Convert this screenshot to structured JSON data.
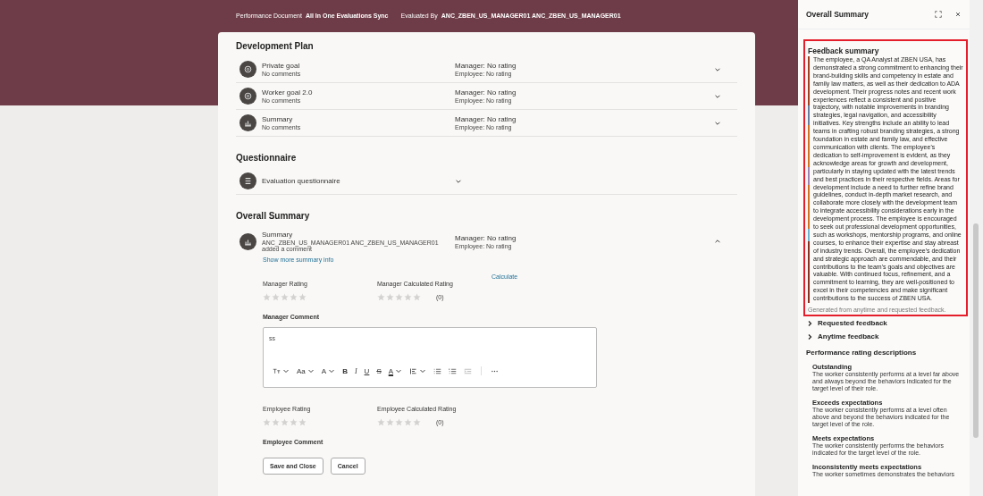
{
  "header": {
    "fields": [
      {
        "label": "Performance Document",
        "value": "All In One Evaluations Sync"
      },
      {
        "label": "Evaluated By",
        "value": "ANC_ZBEN_US_MANAGER01 ANC_ZBEN_US_MANAGER01"
      }
    ]
  },
  "development_plan": {
    "title": "Development Plan",
    "items": [
      {
        "kind": "goal",
        "name": "Private goal",
        "comment": "No comments",
        "manager": "Manager: No rating",
        "employee": "Employee: No rating",
        "expanded": false
      },
      {
        "kind": "goal",
        "name": "Worker goal 2.0",
        "comment": "No comments",
        "manager": "Manager: No rating",
        "employee": "Employee: No rating",
        "expanded": false
      },
      {
        "kind": "summary",
        "name": "Summary",
        "comment": "No comments",
        "manager": "Manager: No rating",
        "employee": "Employee: No rating",
        "expanded": false
      }
    ]
  },
  "questionnaire": {
    "title": "Questionnaire",
    "items": [
      {
        "kind": "questionnaire",
        "name": "Evaluation questionnaire",
        "expanded": false
      }
    ]
  },
  "overall_summary": {
    "title": "Overall Summary",
    "item": {
      "kind": "summary",
      "name": "Summary",
      "comment": "ANC_ZBEN_US_MANAGER01 ANC_ZBEN_US_MANAGER01 added a comment",
      "manager": "Manager: No rating",
      "employee": "Employee: No rating",
      "expanded": true
    },
    "link": "Show more summary info",
    "manager_ratings": [
      {
        "label": "Manager Rating",
        "stars": 0
      },
      {
        "label": "Manager Calculated Rating",
        "stars": 0,
        "count": "(0)",
        "action": "Calculate"
      }
    ],
    "manager_comment": {
      "label": "Manager Comment",
      "value": "ss"
    },
    "toolbar": [
      {
        "kind": "heading",
        "dropdown": true
      },
      {
        "kind": "text",
        "label": "Aa",
        "dropdown": true
      },
      {
        "kind": "text",
        "label": "A",
        "dropdown": true
      },
      {
        "kind": "bold",
        "label": "B"
      },
      {
        "kind": "italic",
        "label": "I"
      },
      {
        "kind": "underline",
        "label": "U"
      },
      {
        "kind": "strike",
        "label": "S"
      },
      {
        "kind": "color",
        "label": "A",
        "dropdown": true
      },
      {
        "kind": "align",
        "dropdown": true
      },
      {
        "kind": "bullets"
      },
      {
        "kind": "numbers"
      },
      {
        "kind": "indent",
        "disabled": true
      },
      {
        "kind": "more"
      }
    ],
    "employee_ratings": [
      {
        "label": "Employee Rating",
        "stars": 0
      },
      {
        "label": "Employee Calculated Rating",
        "stars": 0,
        "count": "(0)"
      }
    ],
    "employee_comment": {
      "label": "Employee Comment"
    },
    "buttons": [
      "Save and Close",
      "Cancel"
    ]
  },
  "panel": {
    "title": "Overall Summary",
    "feedback": {
      "title": "Feedback summary",
      "text": "The employee, a QA Analyst at ZBEN USA, has demonstrated a strong commitment to enhancing their brand-building skills and competency in estate and family law matters, as well as their dedication to ADA development. Their progress notes and recent work experiences reflect a consistent and positive trajectory, with notable improvements in branding strategies, legal navigation, and accessibility initiatives. Key strengths include an ability to lead teams in crafting robust branding strategies, a strong foundation in estate and family law, and effective communication with clients. The employee's dedication to self-improvement is evident, as they acknowledge areas for growth and development, particularly in staying updated with the latest trends and best practices in their respective fields. Areas for development include a need to further refine brand guidelines, conduct in-depth market research, and collaborate more closely with the development team to integrate accessibility considerations early in the development process. The employee is encouraged to seek out professional development opportunities, such as workshops, mentorship programs, and online courses, to enhance their expertise and stay abreast of industry trends. Overall, the employee's dedication and strategic approach are commendable, and their contributions to the team's goals and objectives are valuable. With continued focus, refinement, and a commitment to learning, they are well-positioned to excel in their competencies and make significant contributions to the success of ZBEN USA.",
      "footnote": "Generated from anytime and requested feedback."
    },
    "sections": [
      {
        "label": "Requested feedback",
        "expanded": false
      },
      {
        "label": "Anytime feedback",
        "expanded": false
      }
    ],
    "ratings_title": "Performance rating descriptions",
    "descriptions": [
      {
        "title": "Outstanding",
        "text": "The worker consistently performs at a level far above and always beyond the behaviors indicated for the target level of their role."
      },
      {
        "title": "Exceeds expectations",
        "text": "The worker consistently performs at a level often above and beyond the behaviors indicated for the target level of the role."
      },
      {
        "title": "Meets expectations",
        "text": "The worker consistently performs the behaviors indicated for the target level of the role."
      },
      {
        "title": "Inconsistently meets expectations",
        "text": "The worker sometimes demonstrates the behaviors"
      }
    ]
  }
}
